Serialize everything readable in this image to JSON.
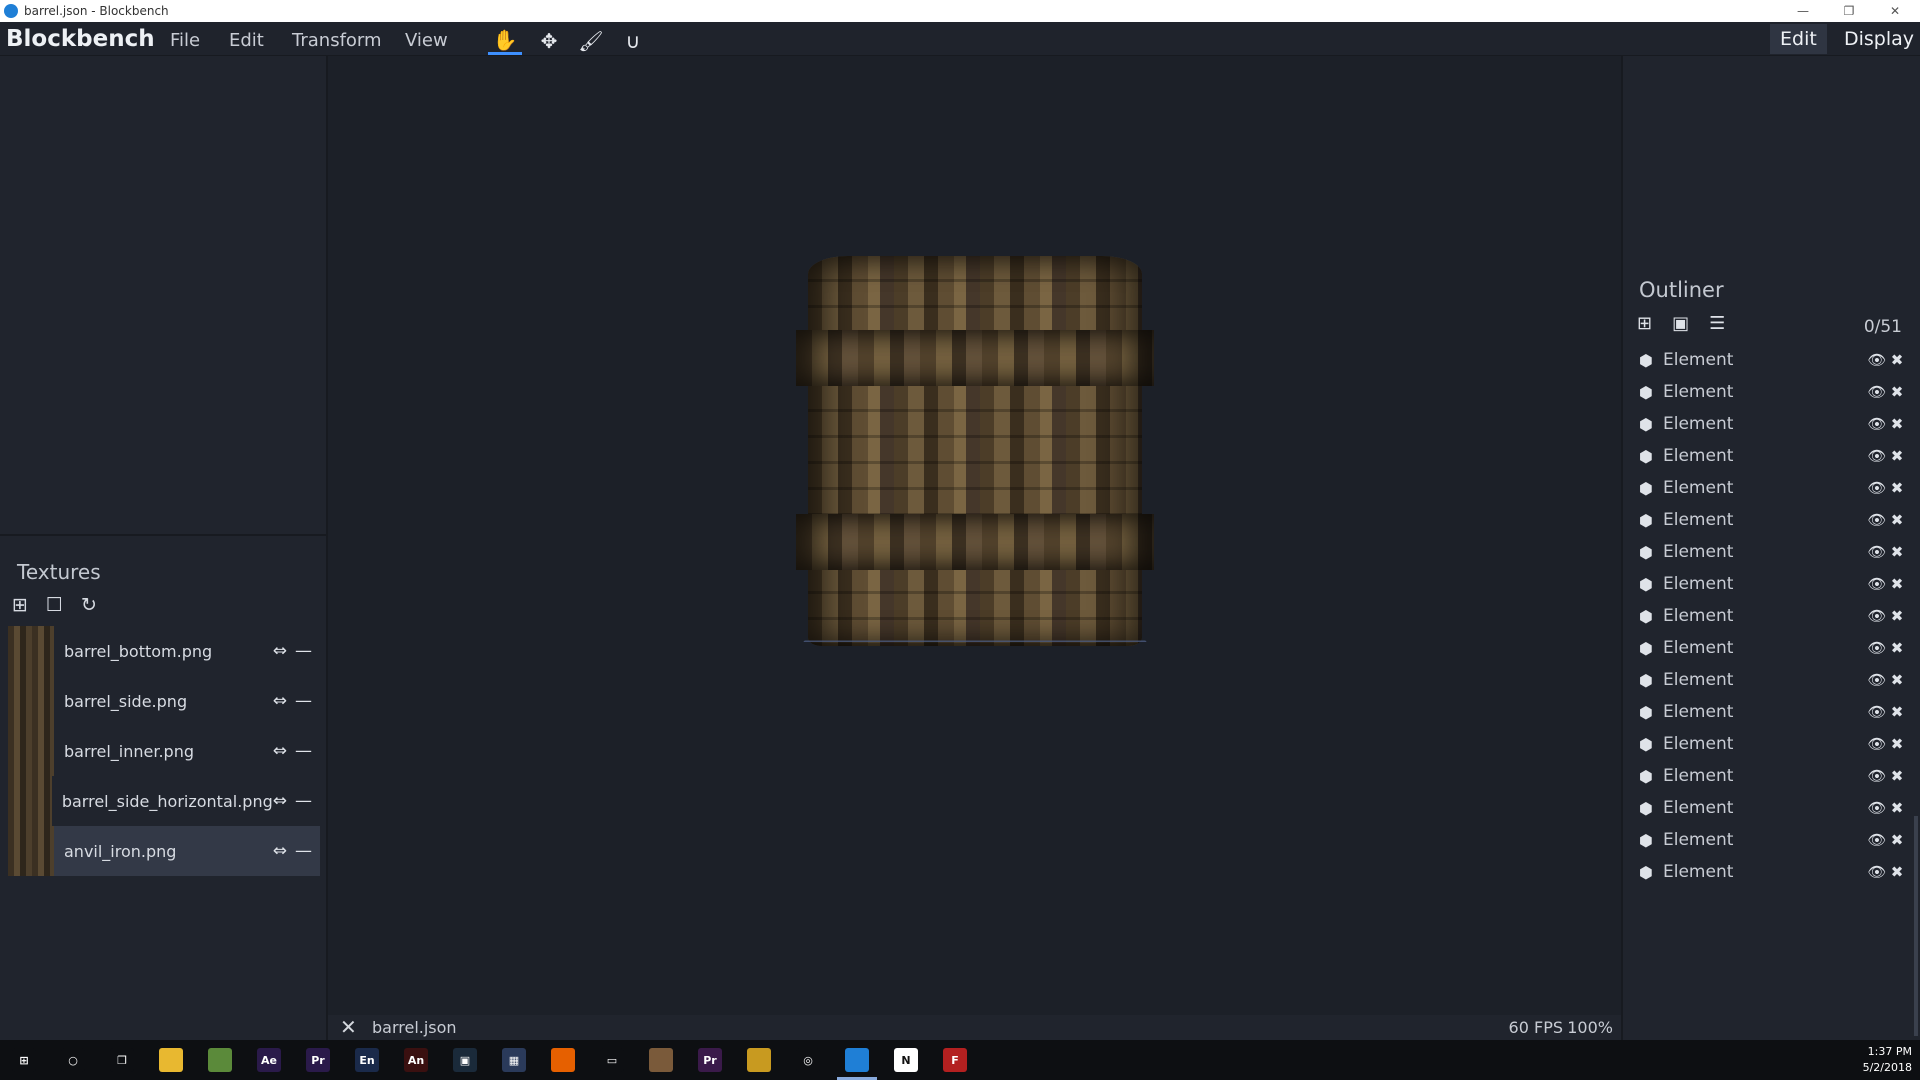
{
  "window": {
    "title": "barrel.json - Blockbench",
    "controls": [
      "—",
      "❐",
      "✕"
    ]
  },
  "menubar": {
    "brand": "Blockbench",
    "menus": [
      "File",
      "Edit",
      "Transform",
      "View"
    ],
    "tools": [
      {
        "icon": "hand-icon",
        "glyph": "✋",
        "active": true
      },
      {
        "icon": "move-icon",
        "glyph": "✥",
        "active": false
      },
      {
        "icon": "brush-icon",
        "glyph": "🖌",
        "active": false
      },
      {
        "icon": "magnet-icon",
        "glyph": "∪",
        "active": false
      }
    ],
    "modes": [
      "Edit",
      "Display"
    ],
    "active_mode": "Edit"
  },
  "textures": {
    "title": "Textures",
    "toolbar": [
      {
        "icon": "import-texture-icon",
        "glyph": "⊞"
      },
      {
        "icon": "blank-texture-icon",
        "glyph": "☐"
      },
      {
        "icon": "reload-icon",
        "glyph": "↻"
      }
    ],
    "items": [
      {
        "name": "barrel_bottom.png",
        "link": "⇔",
        "remove": "—",
        "selected": false
      },
      {
        "name": "barrel_side.png",
        "link": "⇔",
        "remove": "—",
        "selected": false
      },
      {
        "name": "barrel_inner.png",
        "link": "⇔",
        "remove": "—",
        "selected": false
      },
      {
        "name": "barrel_side_horizontal.png",
        "link": "⇔",
        "remove": "—",
        "selected": false
      },
      {
        "name": "anvil_iron.png",
        "link": "⇔",
        "remove": "—",
        "selected": true
      }
    ]
  },
  "outliner": {
    "title": "Outliner",
    "count": "0/51",
    "toolbar": [
      {
        "icon": "add-cube-icon",
        "glyph": "⊞"
      },
      {
        "icon": "add-group-icon",
        "glyph": "▣"
      },
      {
        "icon": "collapse-icon",
        "glyph": "☰"
      }
    ],
    "items": [
      "Element",
      "Element",
      "Element",
      "Element",
      "Element",
      "Element",
      "Element",
      "Element",
      "Element",
      "Element",
      "Element",
      "Element",
      "Element",
      "Element",
      "Element",
      "Element",
      "Element"
    ],
    "visible_glyph": "👁",
    "delete_glyph": "✖",
    "cube_glyph": "⬢"
  },
  "status": {
    "close": "✕",
    "filename": "barrel.json",
    "fps": "60 FPS",
    "zoom": "100%"
  },
  "taskbar": {
    "time": "1:37 PM",
    "date": "5/2/2018",
    "apps": [
      {
        "name": "start-icon",
        "label": "⊞",
        "color": "#0d0f12"
      },
      {
        "name": "search-icon",
        "label": "○",
        "color": "#0d0f12"
      },
      {
        "name": "task-view-icon",
        "label": "❐",
        "color": "#0d0f12"
      },
      {
        "name": "file-explorer-icon",
        "label": "",
        "color": "#e8b830"
      },
      {
        "name": "minecraft-icon",
        "label": "",
        "color": "#5b8a3a"
      },
      {
        "name": "after-effects-icon",
        "label": "Ae",
        "color": "#2a1a4a"
      },
      {
        "name": "premiere-icon",
        "label": "Pr",
        "color": "#2a1a4a"
      },
      {
        "name": "encore-icon",
        "label": "En",
        "color": "#1a2a4a"
      },
      {
        "name": "animate-icon",
        "label": "An",
        "color": "#3a1010"
      },
      {
        "name": "media-encoder-icon",
        "label": "▣",
        "color": "#1a2a3a"
      },
      {
        "name": "photos-icon",
        "label": "▦",
        "color": "#2a3a5a"
      },
      {
        "name": "firefox-icon",
        "label": "",
        "color": "#e66000"
      },
      {
        "name": "remote-icon",
        "label": "▭",
        "color": "#0d0f12"
      },
      {
        "name": "gimp-icon",
        "label": "",
        "color": "#7a5a3a"
      },
      {
        "name": "premiere-pro-icon",
        "label": "Pr",
        "color": "#3a1a4a"
      },
      {
        "name": "paint-icon",
        "label": "",
        "color": "#c89a20"
      },
      {
        "name": "obs-icon",
        "label": "◎",
        "color": "#0d0f12"
      },
      {
        "name": "blockbench-task-icon",
        "label": "",
        "color": "#1f7fd6"
      },
      {
        "name": "notion-icon",
        "label": "N",
        "color": "#ffffff"
      },
      {
        "name": "filezilla-icon",
        "label": "F",
        "color": "#b32020"
      }
    ]
  },
  "colors": {
    "accent": "#3e90ff",
    "panel": "#20242d",
    "viewport": "#1c2028",
    "selected": "#333947"
  }
}
